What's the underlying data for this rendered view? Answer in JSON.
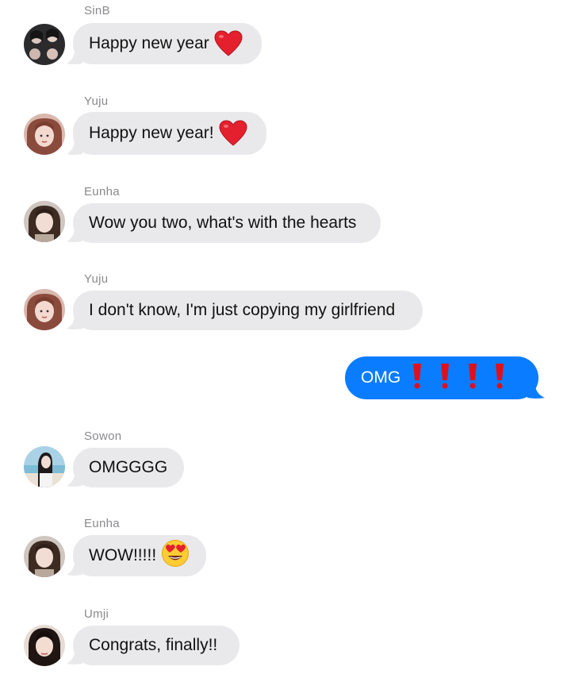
{
  "messages": [
    {
      "sender": "SinB",
      "text": "Happy new year",
      "emoji": "red-heart"
    },
    {
      "sender": "Yuju",
      "text": "Happy new year!",
      "emoji": "red-heart"
    },
    {
      "sender": "Eunha",
      "text": "Wow you two, what's with the hearts"
    },
    {
      "sender": "Yuju",
      "text": "I don't know, I'm just copying my girlfriend"
    },
    {
      "sender": "",
      "text": "OMG",
      "emoji": "red-exclamation-x4",
      "outgoing": true
    },
    {
      "sender": "Sowon",
      "text": "OMGGGG"
    },
    {
      "sender": "Eunha",
      "text": "WOW!!!!!",
      "emoji": "heart-eyes-face"
    },
    {
      "sender": "Umji",
      "text": "Congrats, finally!!"
    }
  ],
  "colors": {
    "incoming_bubble": "#e9e9eb",
    "outgoing_bubble": "#0a7cff",
    "sender_label": "#8a8a8e"
  }
}
